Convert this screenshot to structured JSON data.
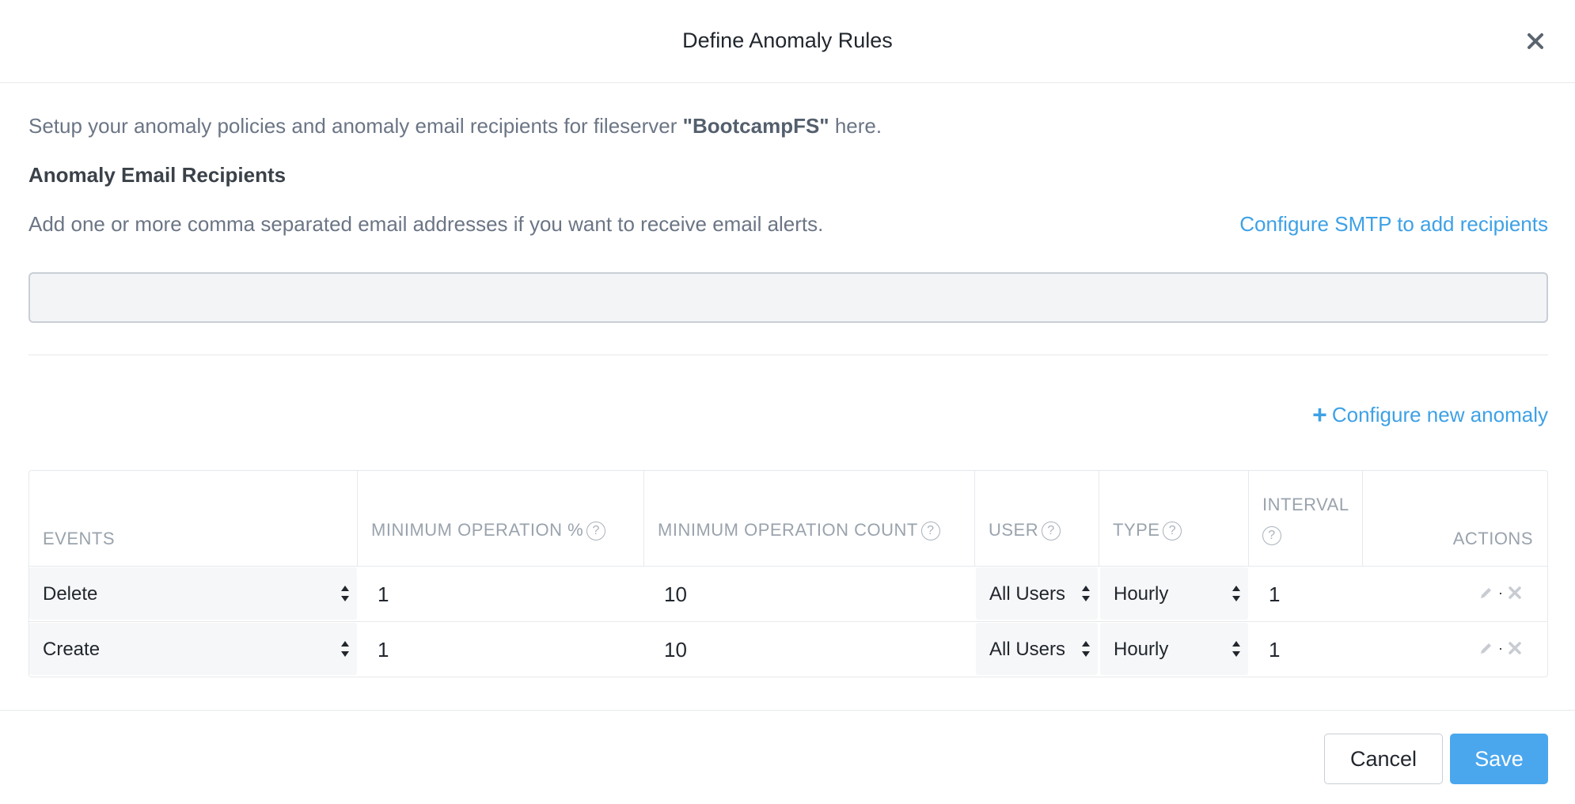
{
  "dialog": {
    "title": "Define Anomaly Rules"
  },
  "intro": {
    "prefix": "Setup your anomaly policies and anomaly email recipients for fileserver ",
    "fileserver": "\"BootcampFS\"",
    "suffix": " here."
  },
  "recipients": {
    "heading": "Anomaly Email Recipients",
    "helper": "Add one or more comma separated email addresses if you want to receive email alerts.",
    "smtp_link": "Configure SMTP to add recipients",
    "email_value": "",
    "email_placeholder": ""
  },
  "anomalies": {
    "add_link_plus": "+",
    "add_link": "Configure new anomaly",
    "columns": {
      "events": "EVENTS",
      "min_op_percent": "MINIMUM OPERATION %",
      "min_op_count": "MINIMUM OPERATION COUNT",
      "user": "USER",
      "type": "TYPE",
      "interval": "INTERVAL",
      "actions": "ACTIONS"
    },
    "help_glyph": "?",
    "rows": [
      {
        "event": "Delete",
        "min_percent": "1",
        "min_count": "10",
        "user": "All Users",
        "type": "Hourly",
        "interval": "1"
      },
      {
        "event": "Create",
        "min_percent": "1",
        "min_count": "10",
        "user": "All Users",
        "type": "Hourly",
        "interval": "1"
      }
    ],
    "action_separator": "·"
  },
  "footer": {
    "cancel": "Cancel",
    "save": "Save"
  },
  "colors": {
    "link": "#3ea1e6",
    "primary_button": "#4aa7ee",
    "muted_text": "#6b7585",
    "header_text": "#9aa3ad"
  }
}
